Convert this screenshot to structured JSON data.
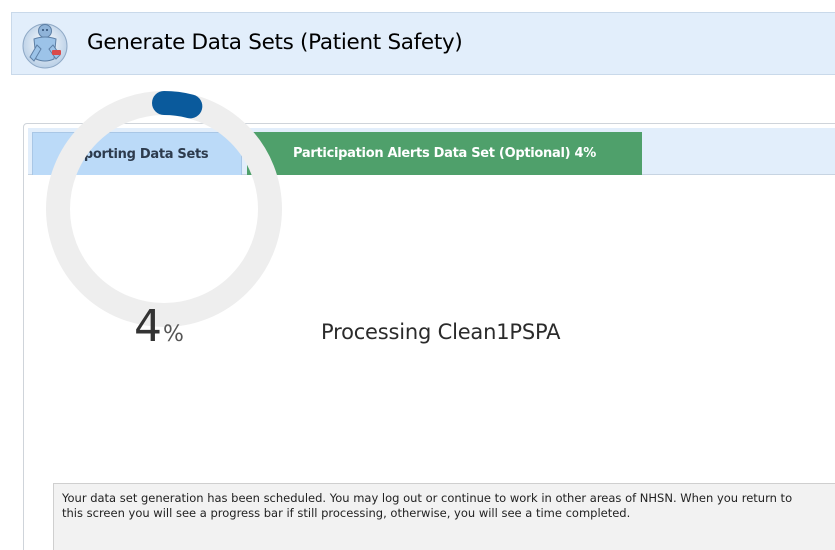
{
  "header": {
    "title": "Generate Data Sets (Patient Safety)",
    "logo_icon": "healthcare-worker-logo"
  },
  "tabs": [
    {
      "label": "Reporting Data Sets",
      "active": false
    },
    {
      "label": "Participation Alerts Data Set (Optional)  4%",
      "active": true
    }
  ],
  "progress": {
    "value": 4,
    "number_text": "4",
    "unit": "%",
    "status_text": "Processing Clean1PSPA"
  },
  "info": {
    "message": "Your data set generation has been scheduled. You may log out or continue to work in other areas of NHSN. When you return to this screen you will see a progress bar if still processing, otherwise, you will see a time completed."
  },
  "colors": {
    "header_bg": "#e2eefb",
    "tab_inactive_bg": "#bbdaf8",
    "tab_active_bg": "#4fa06b",
    "ring_track": "#eeeeee",
    "ring_progress": "#0a5a9c"
  }
}
